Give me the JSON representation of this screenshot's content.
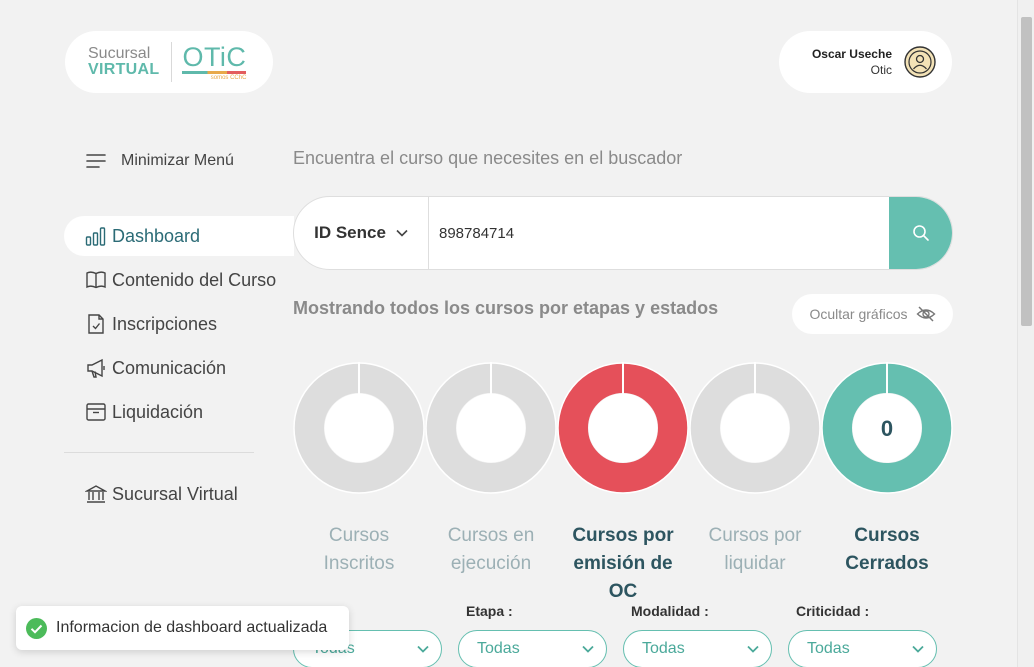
{
  "header": {
    "logo": {
      "line1": "Sucursal",
      "line2": "VIRTUAL",
      "brand": "OTiC",
      "brand_sub": "somos CChC"
    },
    "user": {
      "name": "Oscar Useche",
      "org": "Otic"
    }
  },
  "sidebar": {
    "toggle_label": "Minimizar Menú",
    "items": [
      {
        "label": "Dashboard",
        "icon": "bar-chart-icon",
        "active": true
      },
      {
        "label": "Contenido del Curso",
        "icon": "book-icon"
      },
      {
        "label": "Inscripciones",
        "icon": "document-check-icon"
      },
      {
        "label": "Comunicación",
        "icon": "megaphone-icon"
      },
      {
        "label": "Liquidación",
        "icon": "archive-icon"
      }
    ],
    "bottom_item": {
      "label": "Sucursal Virtual",
      "icon": "bank-icon"
    }
  },
  "main": {
    "search_hint": "Encuentra el curso que necesites en el buscador",
    "search": {
      "type_label": "ID Sence",
      "value": "898784714"
    },
    "section_title": "Mostrando todos los cursos por etapas y estados",
    "hide_charts_label": "Ocultar gráficos",
    "stages": [
      {
        "label": "Cursos Inscritos",
        "status": "inactive",
        "color": "#dddddd",
        "center_value": ""
      },
      {
        "label": "Cursos en ejecución",
        "status": "inactive",
        "color": "#dddddd",
        "center_value": ""
      },
      {
        "label": "Cursos por emisión de OC",
        "status": "active",
        "color": "#e5505a",
        "center_value": ""
      },
      {
        "label": "Cursos por liquidar",
        "status": "inactive",
        "color": "#dddddd",
        "center_value": ""
      },
      {
        "label": "Cursos Cerrados",
        "status": "active",
        "color": "#65bfb0",
        "center_value": "0"
      }
    ],
    "filters": [
      {
        "label": "",
        "value": "Todas"
      },
      {
        "label": "Etapa :",
        "value": "Todas"
      },
      {
        "label": "Modalidad :",
        "value": "Todas"
      },
      {
        "label": "Criticidad :",
        "value": "Todas"
      }
    ]
  },
  "toast": {
    "message": "Informacion de dashboard actualizada"
  },
  "colors": {
    "accent": "#65bfb0",
    "danger": "#e5505a",
    "text_dark": "#2d5560",
    "muted": "#9cb0b5"
  }
}
